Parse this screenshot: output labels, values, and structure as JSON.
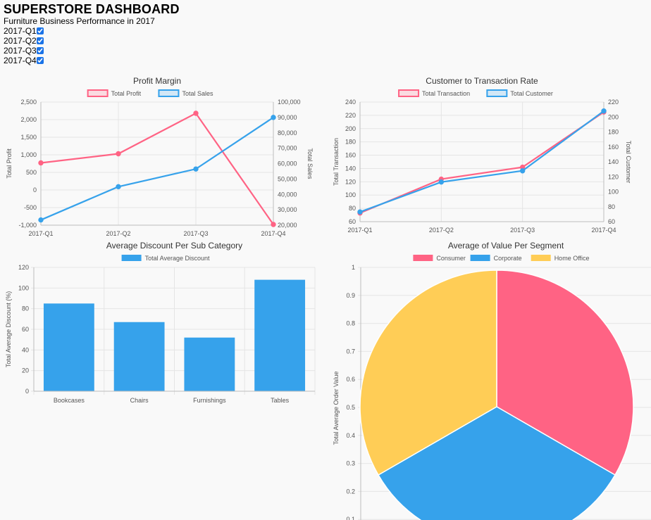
{
  "header": {
    "title": "SUPERSTORE DASHBOARD",
    "subtitle": "Furniture Business Performance in 2017",
    "quarters": [
      {
        "label": "2017-Q1",
        "checked": true
      },
      {
        "label": "2017-Q2",
        "checked": true
      },
      {
        "label": "2017-Q3",
        "checked": true
      },
      {
        "label": "2017-Q4",
        "checked": true
      }
    ]
  },
  "colors": {
    "red": "#ff6384",
    "blue": "#36a2eb",
    "yellow": "#ffcd56",
    "grid": "#e5e5e5",
    "axis": "#bdbdbd"
  },
  "chart_data": [
    {
      "id": "profit",
      "type": "line",
      "title": "Profit Margin",
      "categories": [
        "2017-Q1",
        "2017-Q2",
        "2017-Q3",
        "2017-Q4"
      ],
      "ylabel": "Total Profit",
      "y2label": "Total Sales",
      "ylim": [
        -1000,
        2500
      ],
      "y2lim": [
        20000,
        100000
      ],
      "yticks": [
        "2,500",
        "2,000",
        "1,500",
        "1,000",
        "500",
        "0",
        "-500",
        "-1,000"
      ],
      "y2ticks": [
        "100,000",
        "90,000",
        "80,000",
        "70,000",
        "60,000",
        "50,000",
        "40,000",
        "30,000",
        "20,000"
      ],
      "series": [
        {
          "name": "Total Profit",
          "axis": "left",
          "values": [
            770,
            1030,
            2180,
            -980
          ]
        },
        {
          "name": "Total Sales",
          "axis": "right",
          "values": [
            23400,
            45000,
            56500,
            90000
          ]
        }
      ],
      "grid": true,
      "legend": "top"
    },
    {
      "id": "customer",
      "type": "line",
      "title": "Customer to Transaction Rate",
      "categories": [
        "2017-Q1",
        "2017-Q2",
        "2017-Q3",
        "2017-Q4"
      ],
      "ylabel": "Total Transaction",
      "y2label": "Total Customer",
      "ylim": [
        60,
        240
      ],
      "y2lim": [
        60,
        220
      ],
      "yticks": [
        "240",
        "220",
        "200",
        "180",
        "160",
        "140",
        "120",
        "100",
        "80",
        "60"
      ],
      "y2ticks": [
        "220",
        "200",
        "180",
        "160",
        "140",
        "120",
        "100",
        "80",
        "60"
      ],
      "series": [
        {
          "name": "Total Transaction",
          "axis": "left",
          "values": [
            73,
            124,
            142,
            225
          ]
        },
        {
          "name": "Total Customer",
          "axis": "right",
          "values": [
            73,
            113,
            128,
            208
          ]
        }
      ],
      "grid": true,
      "legend": "top"
    },
    {
      "id": "discount",
      "type": "bar",
      "title": "Average Discount Per Sub Category",
      "categories": [
        "Bookcases",
        "Chairs",
        "Furnishings",
        "Tables"
      ],
      "ylabel": "Total Average Discount (%)",
      "ylim": [
        0,
        120
      ],
      "yticks": [
        "120",
        "100",
        "80",
        "60",
        "40",
        "20",
        "0"
      ],
      "series": [
        {
          "name": "Total Average Discount",
          "values": [
            85,
            67,
            52,
            108
          ]
        }
      ],
      "grid": true,
      "legend": "top"
    },
    {
      "id": "segment",
      "type": "pie",
      "title": "Average of Value Per Segment",
      "ylabel": "Total Average Order Value",
      "yticks": [
        "1",
        "0.9",
        "0.8",
        "0.7",
        "0.6",
        "0.5",
        "0.4",
        "0.3",
        "0.2",
        "0.1"
      ],
      "labels": [
        "Consumer",
        "Corporate",
        "Home Office"
      ],
      "values": [
        1,
        1,
        1
      ],
      "legend": "top"
    }
  ]
}
